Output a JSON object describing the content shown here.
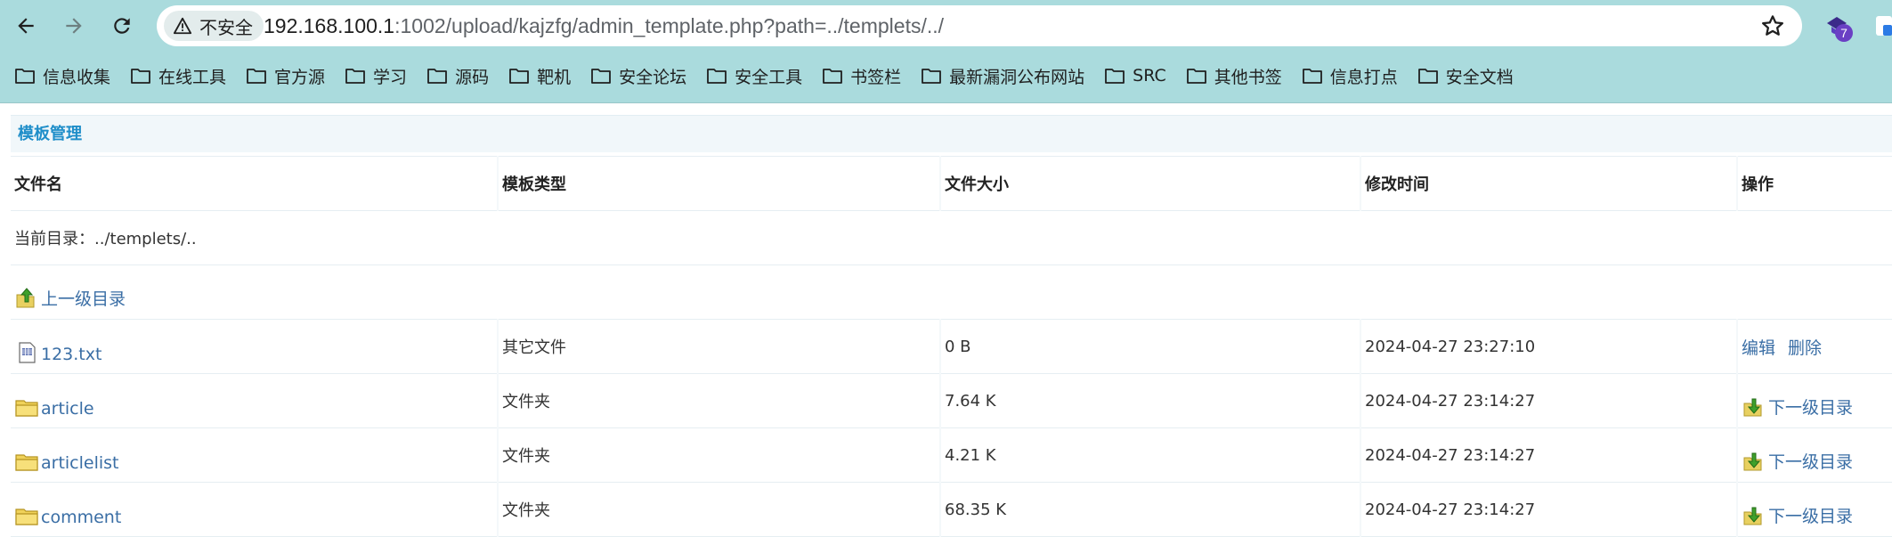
{
  "browser": {
    "security_label": "不安全",
    "url_host": "192.168.100.1",
    "url_rest": ":1002/upload/kajzfg/admin_template.php?path=../templets/../",
    "extension_badge": "7"
  },
  "bookmarks": [
    {
      "label": "信息收集"
    },
    {
      "label": "在线工具"
    },
    {
      "label": "官方源"
    },
    {
      "label": "学习"
    },
    {
      "label": "源码"
    },
    {
      "label": "靶机"
    },
    {
      "label": "安全论坛"
    },
    {
      "label": "安全工具"
    },
    {
      "label": "书签栏"
    },
    {
      "label": "最新漏洞公布网站"
    },
    {
      "label": "SRC"
    },
    {
      "label": "其他书签"
    },
    {
      "label": "信息打点"
    },
    {
      "label": "安全文档"
    }
  ],
  "page": {
    "panel_title": "模板管理",
    "columns": {
      "name": "文件名",
      "type": "模板类型",
      "size": "文件大小",
      "mtime": "修改时间",
      "ops": "操作"
    },
    "current_dir": "当前目录：../templets/..",
    "parent_link": "上一级目录",
    "rows": [
      {
        "name": "123.txt",
        "type": "其它文件",
        "size": "0 B",
        "mtime": "2024-04-27 23:27:10",
        "op1": "编辑",
        "op2": "删除"
      },
      {
        "name": "article",
        "type": "文件夹",
        "size": "7.64 K",
        "mtime": "2024-04-27 23:14:27",
        "op1": "下一级目录"
      },
      {
        "name": "articlelist",
        "type": "文件夹",
        "size": "4.21 K",
        "mtime": "2024-04-27 23:14:27",
        "op1": "下一级目录"
      },
      {
        "name": "comment",
        "type": "文件夹",
        "size": "68.35 K",
        "mtime": "2024-04-27 23:14:27",
        "op1": "下一级目录"
      }
    ]
  },
  "colors": {
    "chrome_bg": "#aadbdd",
    "link": "#3a6ea5",
    "panel_title": "#1f8ec9"
  }
}
